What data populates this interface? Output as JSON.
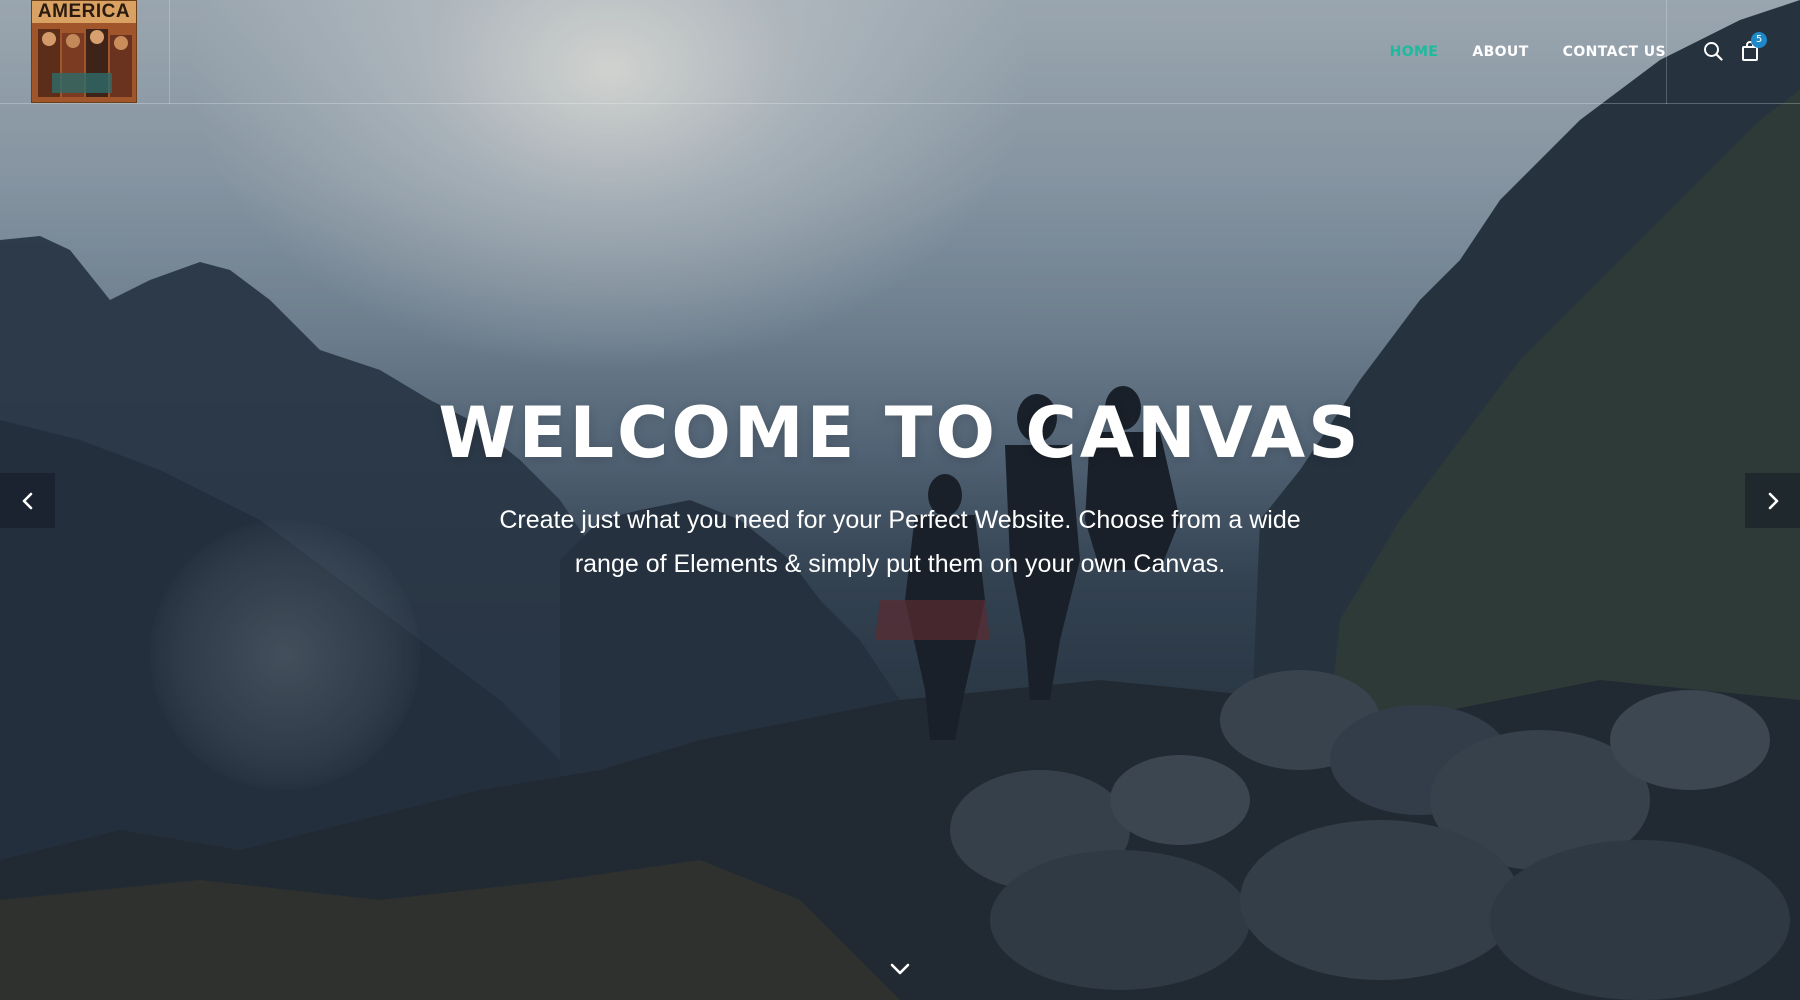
{
  "header": {
    "logo_text": "AMERICA",
    "nav_items": [
      {
        "label": "HOME",
        "active": true
      },
      {
        "label": "ABOUT",
        "active": false
      },
      {
        "label": "CONTACT US",
        "active": false
      }
    ],
    "cart_count": "5",
    "icons": {
      "search": "search-icon",
      "cart": "shopping-bag-icon"
    }
  },
  "hero": {
    "title": "WELCOME TO CANVAS",
    "subtitle": "Create just what you need for your Perfect Website. Choose from a wide range of Elements & simply put them on your own Canvas.",
    "icons": {
      "prev": "chevron-left-icon",
      "next": "chevron-right-icon",
      "scroll": "chevron-down-icon"
    }
  },
  "colors": {
    "accent": "#1abc9c",
    "badge": "#1e88c8",
    "nav_text": "#ffffff"
  }
}
